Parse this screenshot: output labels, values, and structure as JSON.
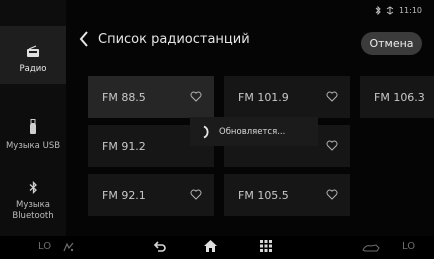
{
  "status": {
    "time": "11:10",
    "icons": [
      "bluetooth-icon",
      "sync-icon"
    ]
  },
  "sidebar": {
    "items": [
      {
        "label": "Радио",
        "icon": "radio-icon",
        "active": true
      },
      {
        "label": "Музыка USB",
        "icon": "usb-icon",
        "active": false
      },
      {
        "label": "Музыка Bluetooth",
        "icon": "bluetooth-icon",
        "active": false
      }
    ]
  },
  "header": {
    "title": "Список радиостанций",
    "cancel_label": "Отмена"
  },
  "stations": [
    {
      "freq": "FM 88.5",
      "active": true
    },
    {
      "freq": "FM 101.9",
      "active": false
    },
    {
      "freq": "FM 106.3",
      "active": false
    },
    {
      "freq": "FM 91.2",
      "active": false
    },
    {
      "freq": "",
      "active": false
    },
    {
      "freq": "FM 92.1",
      "active": false
    },
    {
      "freq": "FM 105.5",
      "active": false
    }
  ],
  "popup": {
    "text": "Обновляется..."
  },
  "bottom_bar": {
    "left_label": "LO",
    "right_label": "LO",
    "icons": [
      "fan-icon",
      "back-icon",
      "home-icon",
      "apps-icon",
      "seat-heat-icon"
    ]
  },
  "colors": {
    "background": "#050505",
    "tile": "#161616",
    "tile_active": "#262626",
    "button": "#3b3b3b"
  }
}
